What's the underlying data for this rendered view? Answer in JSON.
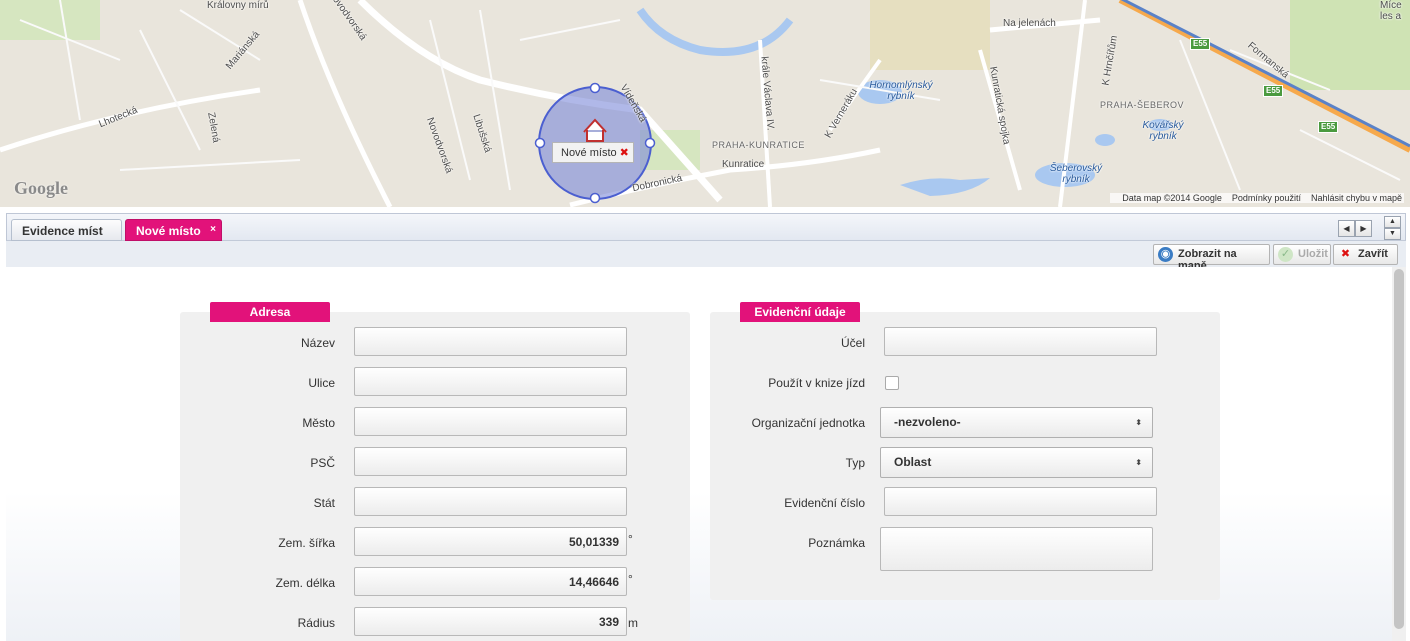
{
  "map": {
    "labels": [
      {
        "text": "Královny mírů",
        "cls": ""
      },
      {
        "text": "Mariánská",
        "cls": ""
      },
      {
        "text": "Lhotecká",
        "cls": ""
      },
      {
        "text": "Zelená",
        "cls": ""
      },
      {
        "text": "Novodvorská",
        "cls": ""
      },
      {
        "text": "Novodvorská",
        "cls": ""
      },
      {
        "text": "Libušská",
        "cls": ""
      },
      {
        "text": "Vídeňská",
        "cls": ""
      },
      {
        "text": "Dobronická",
        "cls": ""
      },
      {
        "text": "krále Václava IV.",
        "cls": ""
      },
      {
        "text": "PRAHA-KUNRATICE",
        "cls": "dist"
      },
      {
        "text": "Kunratice",
        "cls": ""
      },
      {
        "text": "K Verneráku",
        "cls": ""
      },
      {
        "text": "Hornomlýnský rybník",
        "cls": "water"
      },
      {
        "text": "Kunratická spojka",
        "cls": ""
      },
      {
        "text": "Na jelenách",
        "cls": ""
      },
      {
        "text": "K Hrnčířům",
        "cls": ""
      },
      {
        "text": "PRAHA-ŠEBEROV",
        "cls": "dist"
      },
      {
        "text": "Kovářský rybník",
        "cls": "water"
      },
      {
        "text": "Šeberovský rybník",
        "cls": "water"
      },
      {
        "text": "Formanská",
        "cls": ""
      },
      {
        "text": "Míce les a",
        "cls": ""
      }
    ],
    "shields": [
      "E55",
      "E55",
      "E55"
    ],
    "google_logo": "Google",
    "footer": {
      "data": "Data map ©2014 Google",
      "terms": "Podmínky použití",
      "report": "Nahlásit chybu v mapě"
    },
    "marker_label": "Nové místo",
    "marker_close": "✖"
  },
  "tabs": {
    "evidence": "Evidence míst",
    "nove": "Nové místo",
    "nove_close": "×",
    "nav_left": "◀",
    "nav_right": "▶",
    "nav_up": "▲",
    "nav_down": "▼"
  },
  "toolbar": {
    "show_on_map": "Zobrazit na mapě",
    "save": "Uložit",
    "close": "Zavřít"
  },
  "adresa": {
    "title": "Adresa",
    "fields": {
      "nazev": {
        "label": "Název",
        "value": ""
      },
      "ulice": {
        "label": "Ulice",
        "value": ""
      },
      "mesto": {
        "label": "Město",
        "value": ""
      },
      "psc": {
        "label": "PSČ",
        "value": ""
      },
      "stat": {
        "label": "Stát",
        "value": ""
      },
      "sirka": {
        "label": "Zem. šířka",
        "value": "50,01339",
        "unit": "°"
      },
      "delka": {
        "label": "Zem. délka",
        "value": "14,46646",
        "unit": "°"
      },
      "radius": {
        "label": "Rádius",
        "value": "339",
        "unit": "m"
      }
    }
  },
  "evidencni": {
    "title": "Evidenční údaje",
    "fields": {
      "ucel": {
        "label": "Účel",
        "value": ""
      },
      "kniha": {
        "label": "Použít v knize jízd",
        "checked": false
      },
      "org": {
        "label": "Organizační jednotka",
        "value": "-nezvoleno-"
      },
      "typ": {
        "label": "Typ",
        "value": "Oblast"
      },
      "cislo": {
        "label": "Evidenční číslo",
        "value": ""
      },
      "poznamka": {
        "label": "Poznámka",
        "value": ""
      }
    },
    "select_arrow": "⬍"
  },
  "colors": {
    "accent": "#e2127a",
    "map_bg": "#e9e5dc",
    "water": "#a9c8f0",
    "park": "#cfe3b4",
    "circle": "#5a6fd1"
  }
}
